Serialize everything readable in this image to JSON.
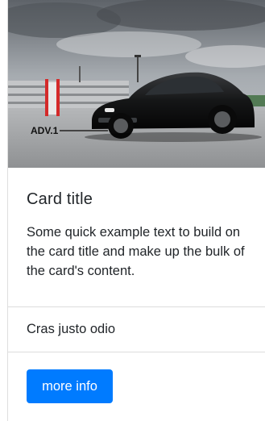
{
  "card": {
    "image_alt": "Black sports car parked on a rooftop under a cloudy sky",
    "image_logo": "ADV.1",
    "title": "Card title",
    "text": "Some quick example text to build on the card title and make up the bulk of the card's content.",
    "list_items": [
      "Cras justo odio"
    ],
    "button_label": "more info"
  },
  "colors": {
    "button_bg": "#007bff",
    "text": "#212529",
    "divider": "#dcdcdc"
  }
}
